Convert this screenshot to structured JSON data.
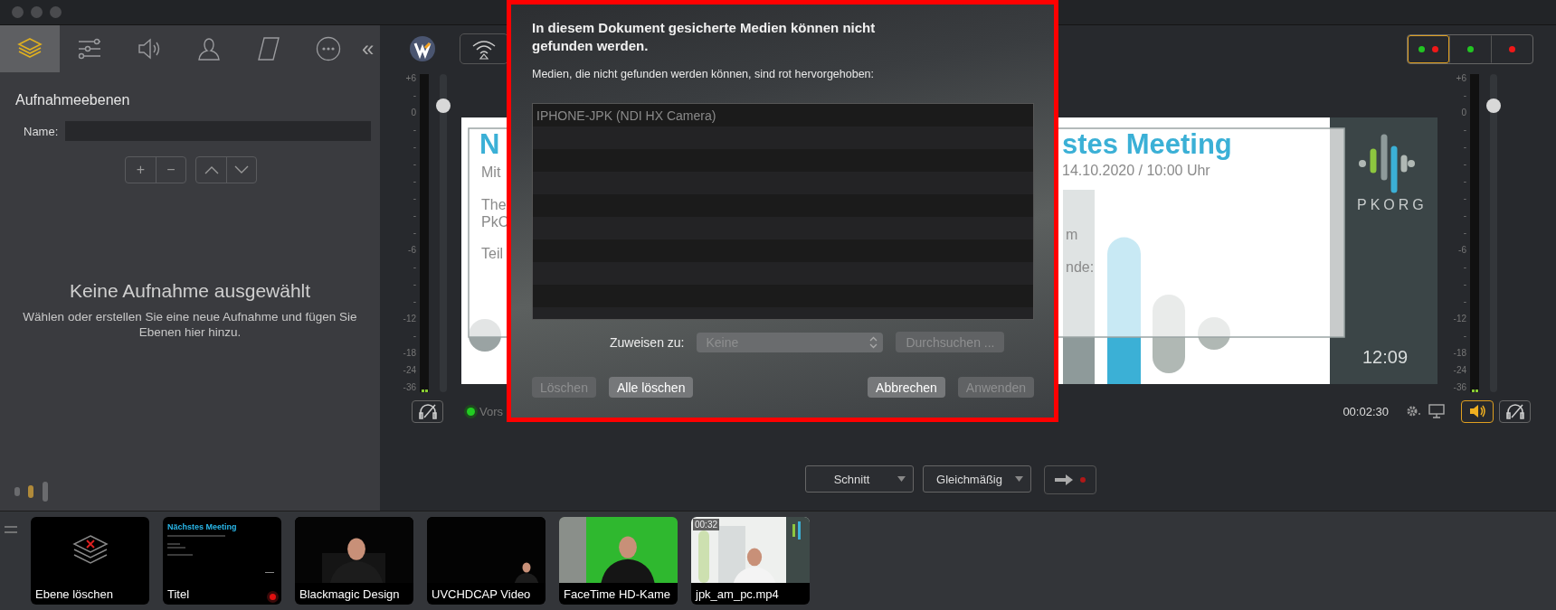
{
  "sidebar_tabs": [
    {
      "kind": "layers",
      "selected": true
    },
    {
      "kind": "sliders",
      "selected": false
    },
    {
      "kind": "audio",
      "selected": false
    },
    {
      "kind": "person",
      "selected": false
    },
    {
      "kind": "shape",
      "selected": false
    },
    {
      "kind": "more",
      "selected": false
    }
  ],
  "sidebar_collapse": "«",
  "layers_panel": {
    "heading": "Aufnahmeebenen",
    "name_label": "Name:",
    "add": "+",
    "remove": "−",
    "empty_title": "Keine Aufnahme ausgewählt",
    "empty_text": "Wählen oder erstellen Sie eine neue Aufnahme und fügen Sie Ebenen hier hinzu."
  },
  "layout_buttons": [
    {
      "selected": true,
      "dots": [
        {
          "color": "#22c522"
        },
        {
          "color": "#f01818"
        }
      ]
    },
    {
      "selected": false,
      "dots": [
        {
          "color": "#22c522"
        }
      ]
    },
    {
      "selected": false,
      "dots": [
        {
          "color": "#f01818"
        }
      ]
    }
  ],
  "left_meter": {
    "scale": [
      "+6",
      "-",
      "0",
      "-",
      "-",
      "-",
      "-",
      "-",
      "-",
      "-",
      "-6",
      "-",
      "-",
      "-",
      "-12",
      "-",
      "-18",
      "-24",
      "-36"
    ],
    "volume": {
      "level": 0.9
    }
  },
  "right_meter": {
    "scale": [
      "+6",
      "-",
      "0",
      "-",
      "-",
      "-",
      "-",
      "-",
      "-",
      "-",
      "-6",
      "-",
      "-",
      "-",
      "-12",
      "-",
      "-18",
      "-24",
      "-36"
    ],
    "volume": {
      "level": 0.9
    }
  },
  "preview": {
    "left_title": "N",
    "left_lines": [
      "Mit",
      "The",
      "PkC",
      "Teil"
    ],
    "right_title": "stes Meeting",
    "right_date": "14.10.2020 / 10:00 Uhr",
    "right_lines": [
      "m",
      "nde:"
    ],
    "logo_text": "PKORG",
    "clock": "12:09"
  },
  "status": {
    "label": "Vors",
    "on": true
  },
  "timecode": "00:02:30",
  "speaker": {
    "on": true
  },
  "transition": {
    "mode": "Schnitt",
    "speed": "Gleichmäßig"
  },
  "shots": [
    {
      "label": "Ebene löschen",
      "kind": "empty-layer"
    },
    {
      "label": "Titel",
      "kind": "title",
      "title": "Nächstes Meeting",
      "live": true
    },
    {
      "label": "Blackmagic Design",
      "kind": "picture"
    },
    {
      "label": "UVCHDCAP Video",
      "kind": "picture"
    },
    {
      "label": "FaceTime HD-Kame",
      "kind": "picture"
    },
    {
      "label": "jpk_am_pc.mp4",
      "kind": "picture",
      "duration": "00:32"
    }
  ],
  "dialog": {
    "title": "In diesem Dokument gesicherte Medien können nicht gefunden werden.",
    "subtitle": "Medien, die nicht gefunden werden können, sind rot hervorgehoben:",
    "items": [
      "IPHONE-JPK (NDI HX Camera)"
    ],
    "assign_label": "Zuweisen zu:",
    "assign_select": {
      "value": "Keine",
      "disabled": true
    },
    "browse": {
      "label": "Durchsuchen ...",
      "disabled": true
    },
    "buttons": [
      {
        "label": "Löschen",
        "disabled": true
      },
      {
        "label": "Alle löschen",
        "disabled": false
      },
      {
        "label": "Abbrechen",
        "disabled": false
      },
      {
        "label": "Anwenden",
        "disabled": true
      }
    ]
  }
}
